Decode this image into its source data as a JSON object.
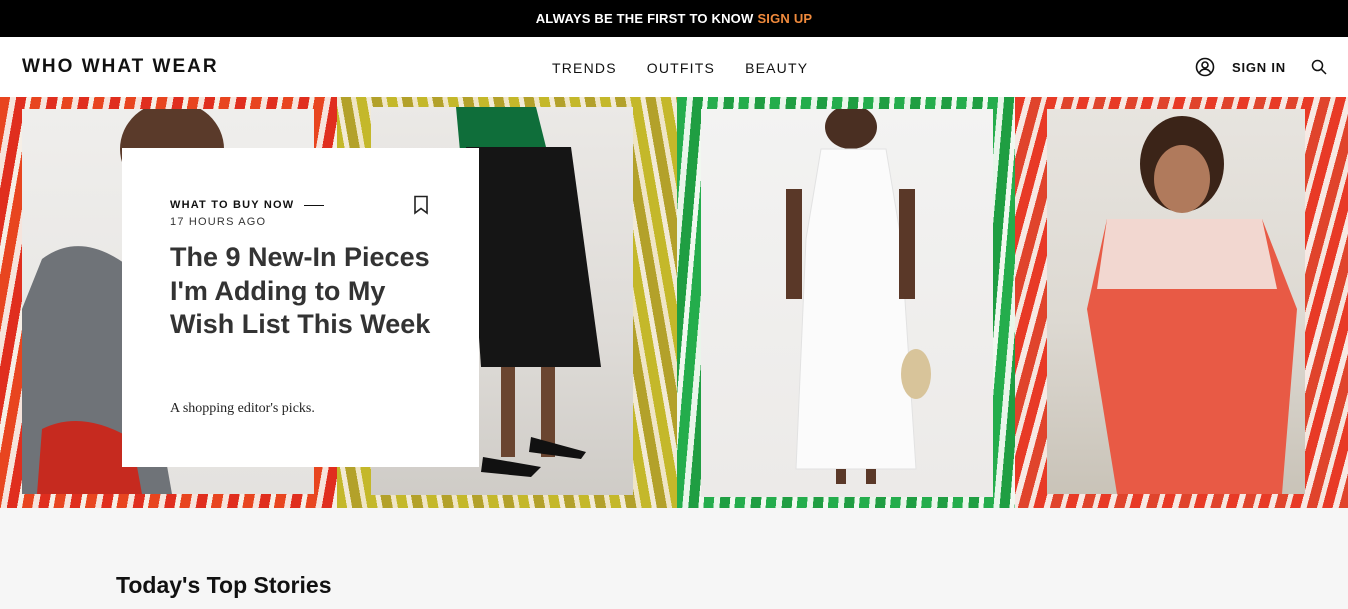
{
  "topbar": {
    "text": "ALWAYS BE THE FIRST TO KNOW",
    "cta": "SIGN UP",
    "cta_color": "#f08a3c"
  },
  "header": {
    "logo": "WHO WHAT WEAR",
    "nav": [
      "TRENDS",
      "OUTFITS",
      "BEAUTY"
    ],
    "user_icon": "user-circle-icon",
    "signin": "SIGN IN",
    "search_icon": "magnifier-icon"
  },
  "hero": {
    "eyebrow": "WHAT TO BUY NOW",
    "time": "17 HOURS AGO",
    "bookmark_icon": "bookmark-icon",
    "headline": "The 9 New-In Pieces I'm Adding to My Wish List This Week",
    "dek": "A shopping editor's picks.",
    "panel_colors": [
      "#e8451f",
      "#c4b82a",
      "#24ad4c",
      "#e83a26"
    ]
  },
  "section": {
    "title": "Today's Top Stories"
  }
}
